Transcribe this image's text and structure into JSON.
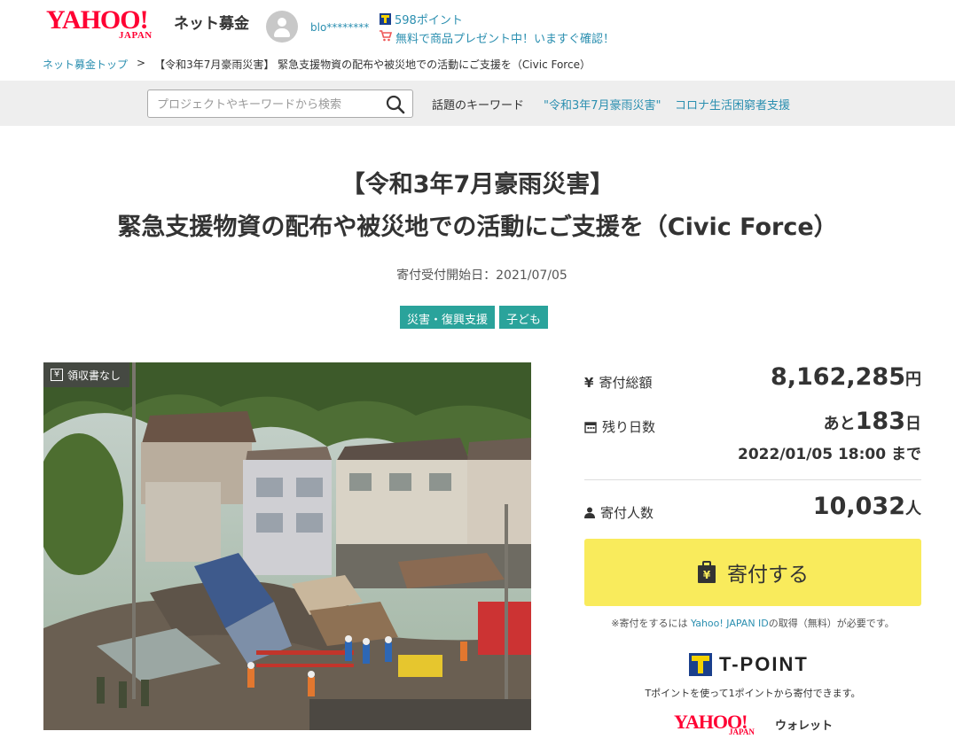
{
  "header": {
    "logo_main": "YAHOO!",
    "logo_sub": "JAPAN",
    "service_name": "ネット募金",
    "username": "blo********",
    "points": "598ポイント",
    "promo": "無料で商品プレゼント中！いますぐ確認！"
  },
  "breadcrumb": {
    "home": "ネット募金トップ",
    "separator": ">",
    "current": "【令和3年7月豪雨災害】 緊急支援物資の配布や被災地での活動にご支援を（Civic Force）"
  },
  "search": {
    "placeholder": "プロジェクトやキーワードから検索",
    "keywords_label": "話題のキーワード",
    "keywords": [
      "\"令和3年7月豪雨災害\"",
      "コロナ生活困窮者支援"
    ]
  },
  "project": {
    "title_line1": "【令和3年7月豪雨災害】",
    "title_line2": "緊急支援物資の配布や被災地での活動にご支援を（Civic Force）",
    "start_date": "寄付受付開始日：2021/07/05",
    "tags": [
      "災害・復興支援",
      "子ども"
    ],
    "receipt_badge": "領収書なし"
  },
  "stats": {
    "total_label": "寄付総額",
    "total_value": "8,162,285",
    "total_unit": "円",
    "days_label": "残り日数",
    "days_prefix": "あと",
    "days_value": "183",
    "days_unit": "日",
    "deadline": "2022/01/05 18:00 まで",
    "donors_label": "寄付人数",
    "donors_value": "10,032",
    "donors_unit": "人"
  },
  "donate": {
    "button_label": "寄付する",
    "note_prefix": "※寄付をするには ",
    "note_link": "Yahoo! JAPAN ID",
    "note_suffix": "の取得（無料）が必要です。",
    "tpoint_logo": "T-POINT",
    "tpoint_note": "Tポイントを使って1ポイントから寄付できます。",
    "wallet_main": "YAHOO!",
    "wallet_sub": "JAPAN",
    "wallet_label": "ウォレット"
  },
  "colors": {
    "accent": "#2aa39b",
    "link": "#2b8fb0",
    "brand_red": "#ff0033",
    "donate_yellow": "#f9eb5c"
  }
}
